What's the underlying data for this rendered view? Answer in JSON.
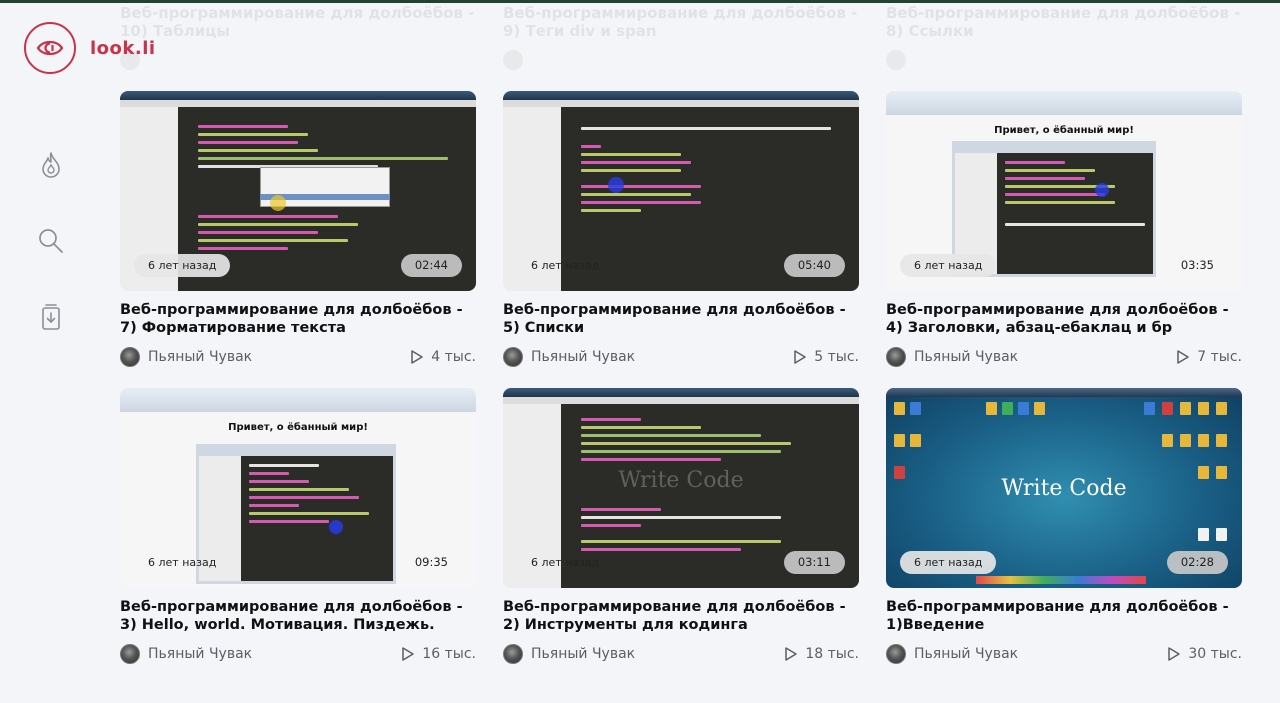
{
  "brand": {
    "name": "look.li",
    "accent": "#c8334a"
  },
  "nav": [
    {
      "icon": "flame-icon",
      "name": "nav-trending"
    },
    {
      "icon": "search-icon",
      "name": "nav-search"
    },
    {
      "icon": "download-icon",
      "name": "nav-downloads"
    }
  ],
  "faded_row": [
    {
      "title": "Веб-программирование для долбоёбов - 10) Таблицы"
    },
    {
      "title": "Веб-программирование для долбоёбов - 9) Теги div и span"
    },
    {
      "title": "Веб-программирование для долбоёбов - 8) Ссылки"
    }
  ],
  "videos": [
    {
      "title": "Веб-программирование для долбоёбов - 7) Форматирование текста",
      "channel": "Пьяный Чувак",
      "views": "4 тыс.",
      "age": "6 лет назад",
      "duration": "02:44",
      "thumb_style": "editor-autocomplete"
    },
    {
      "title": "Веб-программирование для долбоёбов - 5) Списки",
      "channel": "Пьяный Чувак",
      "views": "5 тыс.",
      "age": "6 лет назад",
      "duration": "05:40",
      "thumb_style": "editor"
    },
    {
      "title": "Веб-программирование для долбоёбов - 4) Заголовки, абзац-ебаклац и бр",
      "channel": "Пьяный Чувак",
      "views": "7 тыс.",
      "age": "6 лет назад",
      "duration": "03:35",
      "thumb_style": "browser",
      "thumb_heading": "Привет, о ёбанный мир!"
    },
    {
      "title": "Веб-программирование для долбоёбов - 3) Hello, world. Мотивация. Пиздежь.",
      "channel": "Пьяный Чувак",
      "views": "16 тыс.",
      "age": "6 лет назад",
      "duration": "09:35",
      "thumb_style": "browser",
      "thumb_heading": "Привет, о ёбанный мир!"
    },
    {
      "title": "Веб-программирование для долбоёбов - 2) Инструменты для кодинга",
      "channel": "Пьяный Чувак",
      "views": "18 тыс.",
      "age": "6 лет назад",
      "duration": "03:11",
      "thumb_style": "editor-overlay"
    },
    {
      "title": "Веб-программирование для долбоёбов - 1)Введение",
      "channel": "Пьяный Чувак",
      "views": "30 тыс.",
      "age": "6 лет назад",
      "duration": "02:28",
      "thumb_style": "desktop",
      "thumb_heading": "Write Code"
    }
  ]
}
